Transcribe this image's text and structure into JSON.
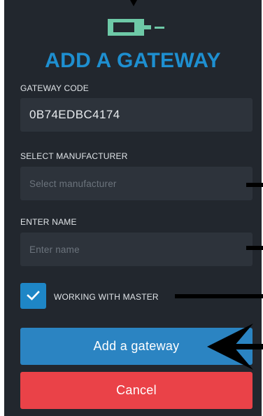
{
  "dialog": {
    "title": "ADD A GATEWAY"
  },
  "gateway_code": {
    "label": "GATEWAY CODE",
    "value": "0B74EDBC4174"
  },
  "manufacturer": {
    "label": "SELECT MANUFACTURER",
    "placeholder": "Select manufacturer"
  },
  "name": {
    "label": "ENTER NAME",
    "placeholder": "Enter name"
  },
  "working_with_master": {
    "label": "WORKING WITH MASTER",
    "checked": true
  },
  "buttons": {
    "add_label": "Add a gateway",
    "cancel_label": "Cancel"
  },
  "colors": {
    "panel_bg": "#22272e",
    "field_bg": "#2d333b",
    "title": "#1e8fd0",
    "primary": "#2b84c2",
    "danger": "#ea4248",
    "logo_green": "#6ec9a7"
  },
  "icons": {
    "logo": "gateway-device-icon",
    "check": "checkmark-icon"
  }
}
